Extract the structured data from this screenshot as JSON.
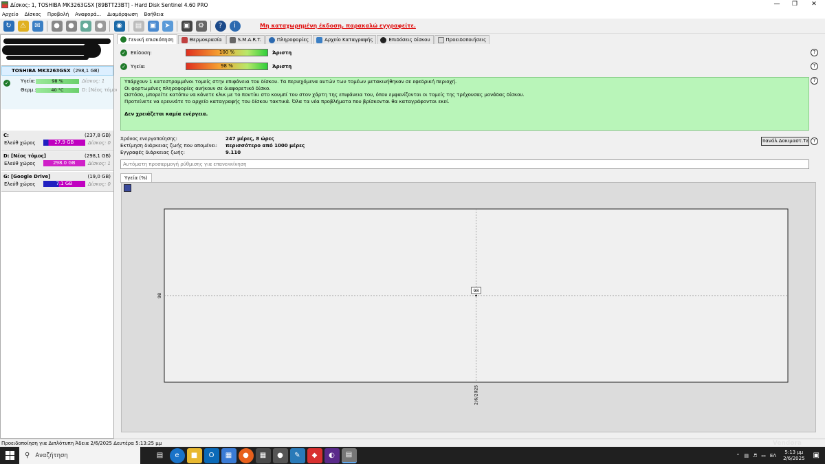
{
  "window": {
    "title": "Δίσκος: 1, TOSHIBA MK3263GSX [89BTT23BT]  -  Hard Disk Sentinel 4.60 PRO"
  },
  "menu": [
    "Αρχείο",
    "Δίσκος",
    "Προβολή",
    "Αναφορά...",
    "Διαμόρφωση",
    "Βοήθεια"
  ],
  "toolbar": {
    "register_warning": "Μη καταχωρημένη έκδοση, παρακαλώ εγγραφείτε."
  },
  "disk": {
    "name": "TOSHIBA MK3263GSX",
    "size": "(298,1 GB)",
    "health_label": "Υγεία:",
    "health_value": "98 %",
    "disk_ref": "Δίσκος: 1",
    "temp_label": "Θερμ.:",
    "temp_value": "40 °C",
    "drive_ref": "D: [Νέος τόμος]"
  },
  "volumes": [
    {
      "name": "C:",
      "size": "(237,8 GB)",
      "free_label": "Ελεύθ χώρος",
      "free": "27.9 GB",
      "free_fraction": 0.12,
      "disk": "Δίσκος: 0",
      "color": "#2020c0"
    },
    {
      "name": "D: [Νέος τόμος]",
      "size": "(298,1 GB)",
      "free_label": "Ελεύθ χώρος",
      "free": "298.0 GB",
      "free_fraction": 1.0,
      "disk": "Δίσκος: 1",
      "color": "#d020c8"
    },
    {
      "name": "G: [Google Drive]",
      "size": "(19,0 GB)",
      "free_label": "Ελεύθ χώρος",
      "free": "7.1 GB",
      "free_fraction": 0.37,
      "disk": "Δίσκος: 0",
      "color": "#2020c0"
    }
  ],
  "tabs": [
    "Γενική επισκόπηση",
    "Θερμοκρασία",
    "S.M.A.R.T.",
    "Πληροφορίες",
    "Αρχείο Καταγραφής",
    "Επιδόσεις δίσκου",
    "Προειδοποιήσεις"
  ],
  "overview": {
    "performance_label": "Επίδοση:",
    "performance_value": "100 %",
    "performance_rating": "Άριστη",
    "health_label": "Υγεία:",
    "health_value": "98 %",
    "health_rating": "Άριστη",
    "message_lines": [
      "Υπάρχουν 1 κατεστραμμένοι τομείς στην επιφάνεια του δίσκου. Τα περιεχόμενα αυτών των τομέων μετακινήθηκαν σε εφεδρική περιοχή.",
      "Οι φορτωμένες πληροφορίες ανήκουν σε διαφορετικό δίσκο.",
      "Ωστόσο, μπορείτε κατόπιν να κάνετε κλικ με το ποντίκι στο κουμπί του  στον  χάρτη της επιφάνεια του, όπου εμφανίζονται οι τομείς της τρέχουσας μονάδας δίσκου.",
      "Προτείνετε να ερευνάτε το αρχείο καταγραφής του δίσκου τακτικά. Όλα τα νέα προβλήματα που βρίσκονται θα καταγράφονται εκεί."
    ],
    "message_bold": "Δεν χρειάζεται καμία ενέργεια.",
    "poweron_label": "Χρόνος ενεργοποίησης:",
    "poweron_value": "247 μέρες, 8 ώρες",
    "lifetime_label": "Εκτίμηση διάρκειας ζωής που απομένει:",
    "lifetime_value": "περισσότερο από 1000 μέρες",
    "lifewrites_label": "Εγγραφές διάρκειας ζωής:",
    "lifewrites_value": "9.110",
    "test_button": "πανάλ.Δοκιμαστ.Τεστ",
    "auto_placeholder": "Αυτόματη προσαρμογή ρύθμισης για επανεκκίνηση",
    "chart_tab": "Υγεία (%)"
  },
  "chart_data": {
    "type": "line",
    "x": [
      "2/6/2025"
    ],
    "series": [
      {
        "values": [
          98
        ]
      }
    ],
    "data_labels": [
      "98"
    ],
    "yticks": [
      "98"
    ],
    "xticks": [
      "2/6/2025"
    ],
    "grid": true
  },
  "statusbar": {
    "text": "Προειδοποίηση για Διπλότυπη  Άδεια 2/6/2025 Δευτέρα 5:13:25 μμ"
  },
  "taskbar": {
    "search_placeholder": "Αναζήτηση",
    "lang": "ΕΛ",
    "time": "5:13 μμ",
    "date": "2/6/2025",
    "watermark": "Vendora"
  }
}
